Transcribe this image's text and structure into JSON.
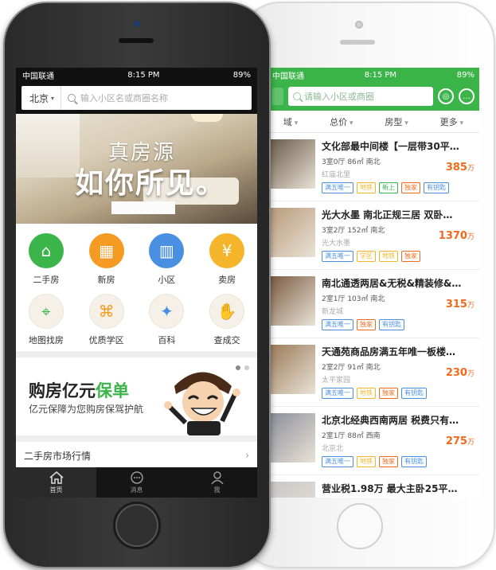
{
  "front_phone": {
    "status": {
      "carrier": "中国联通",
      "time": "8:15 PM",
      "battery": "89%"
    },
    "header": {
      "city": "北京",
      "search_placeholder": "输入小区名或商圈名称"
    },
    "banner": {
      "line1": "真房源",
      "line2": "如你所见。"
    },
    "grid": [
      {
        "label": "二手房",
        "icon": "house-icon",
        "color": "#3bb44a"
      },
      {
        "label": "新房",
        "icon": "building-icon",
        "color": "#f59a23"
      },
      {
        "label": "小区",
        "icon": "apartment-icon",
        "color": "#4a90e2"
      },
      {
        "label": "卖房",
        "icon": "sell-house-icon",
        "color": "#f5b52a"
      },
      {
        "label": "地图找房",
        "icon": "map-pin-icon",
        "color": "#3bb44a"
      },
      {
        "label": "优质学区",
        "icon": "graduation-cap-icon",
        "color": "#f59a23"
      },
      {
        "label": "百科",
        "icon": "bulb-icon",
        "color": "#4a90e2"
      },
      {
        "label": "查成交",
        "icon": "handshake-icon",
        "color": "#f59a23"
      }
    ],
    "promo": {
      "title_prefix": "购房亿元",
      "title_highlight": "保单",
      "subtitle": "亿元保障为您购房保驾护航"
    },
    "market": {
      "label": "二手房市场行情"
    },
    "tabs": [
      {
        "label": "首页"
      },
      {
        "label": "消息"
      },
      {
        "label": "我"
      }
    ]
  },
  "back_phone": {
    "status": {
      "carrier": "中国联通",
      "time": "8:15 PM",
      "battery": "89%"
    },
    "search_placeholder": "请输入小区或商圈",
    "filters": [
      "域",
      "总价",
      "房型",
      "更多"
    ],
    "listings": [
      {
        "title": "文化部最中间楼【一层带30平…",
        "spec": "3室0厅 86㎡ 南北",
        "place": "红庙北里",
        "price": "385",
        "unit": "万",
        "tags": [
          "满五唯一",
          "地铁",
          "新上",
          "独家",
          "有钥匙"
        ],
        "thumb": "#6a5a48"
      },
      {
        "title": "光大水墨 南北正规三居 双卧…",
        "spec": "3室2厅 152㎡ 南北",
        "place": "光大水墨",
        "price": "1370",
        "unit": "万",
        "tags": [
          "满五唯一",
          "学区",
          "地铁",
          "独家"
        ],
        "thumb": "#b89a7a"
      },
      {
        "title": "南北通透两居&无税&精装修&…",
        "spec": "2室1厅 103㎡ 南北",
        "place": "新龙城",
        "price": "315",
        "unit": "万",
        "tags": [
          "满五唯一",
          "独家",
          "有钥匙"
        ],
        "thumb": "#7a5a40"
      },
      {
        "title": "天通苑商品房满五年唯一板楼…",
        "spec": "2室2厅 91㎡ 南北",
        "place": "太平家园",
        "price": "230",
        "unit": "万",
        "tags": [
          "满五唯一",
          "地铁",
          "独家",
          "有钥匙"
        ],
        "thumb": "#9a7a58"
      },
      {
        "title": "北京北经典西南两居 税费只有…",
        "spec": "2室1厅 88㎡ 西南",
        "place": "北京北",
        "price": "275",
        "unit": "万",
        "tags": [
          "满五唯一",
          "地铁",
          "独家",
          "有钥匙"
        ],
        "thumb": "#8c8f9a"
      },
      {
        "title": "营业税1.98万 最大主卧25平…",
        "spec": "",
        "place": "",
        "price": "",
        "unit": "",
        "tags": [],
        "thumb": "#c7c7c7"
      }
    ],
    "tag_colors": {
      "满五唯一": "#4a90e2",
      "地铁": "#f5b52a",
      "新上": "#3bb44a",
      "独家": "#f06a1c",
      "有钥匙": "#4a90e2",
      "学区": "#f5b52a"
    }
  }
}
